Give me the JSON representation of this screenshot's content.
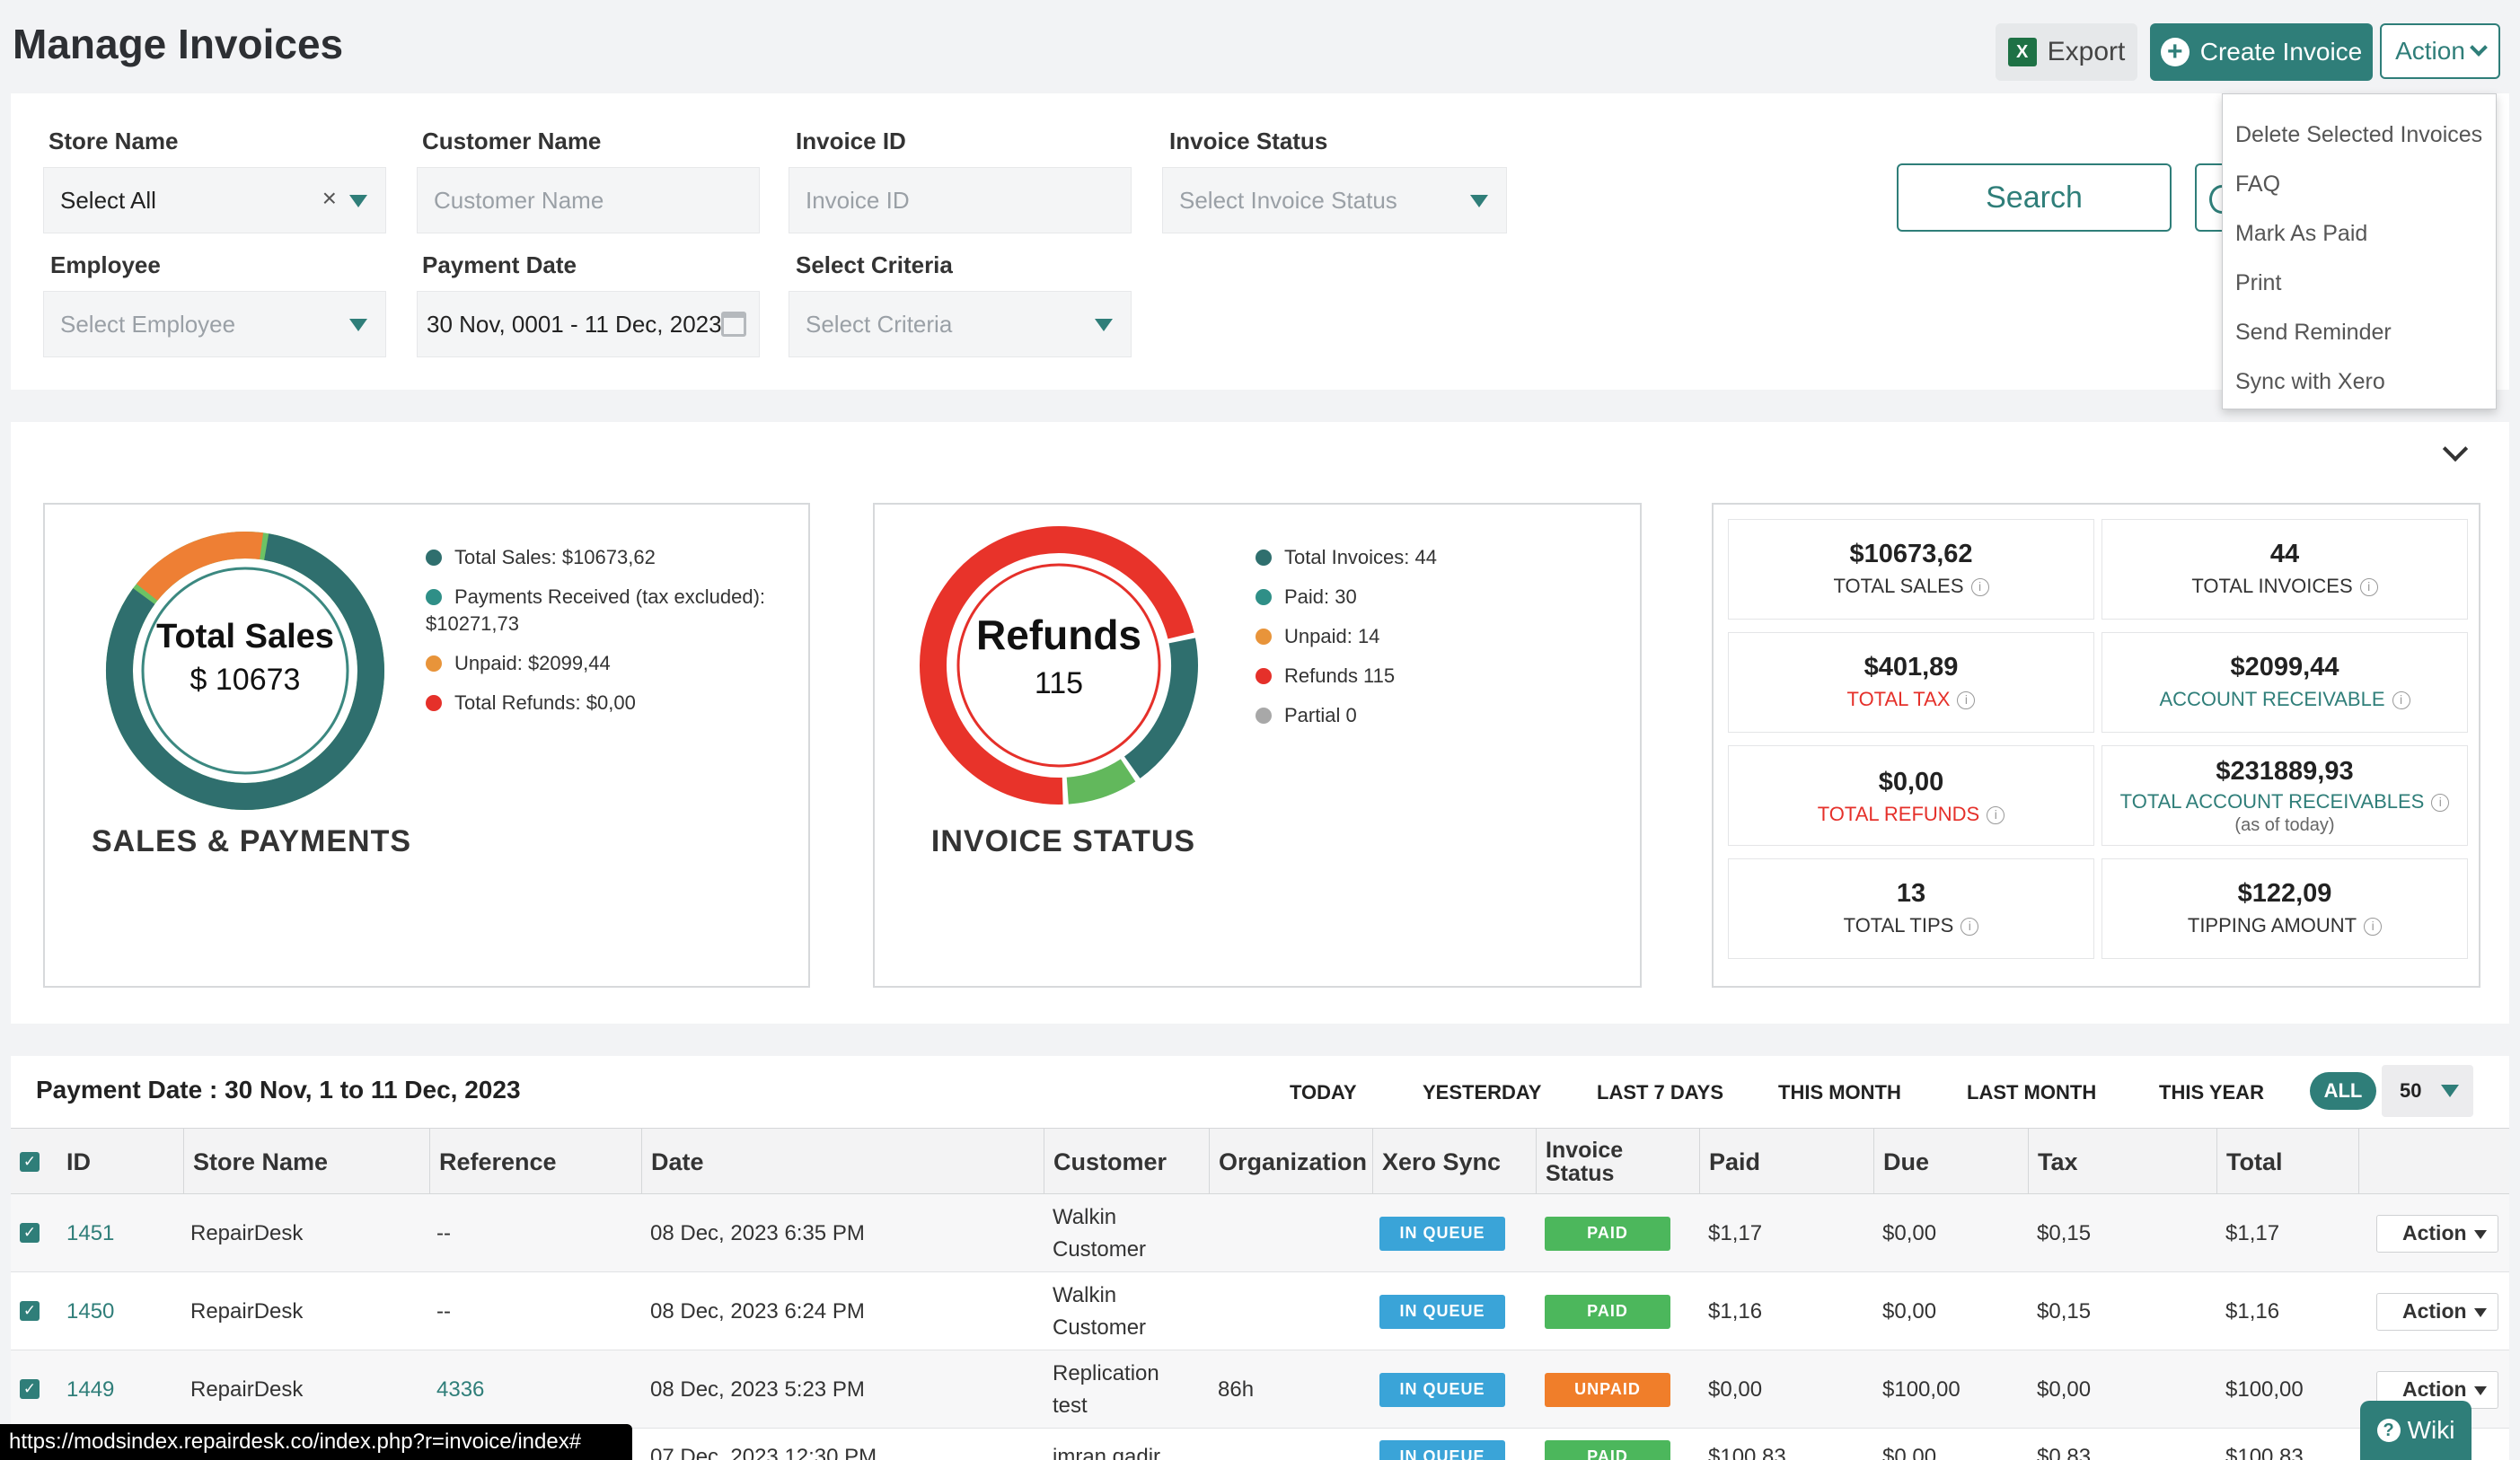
{
  "page": {
    "title": "Manage Invoices"
  },
  "toolbar": {
    "export_label": "Export",
    "create_label": "Create Invoice",
    "action_label": "Action"
  },
  "action_menu": [
    "Delete Selected Invoices",
    "FAQ",
    "Mark As Paid",
    "Print",
    "Send Reminder",
    "Sync with Xero"
  ],
  "filters": {
    "store_name_label": "Store Name",
    "store_name_value": "Select All",
    "customer_name_label": "Customer Name",
    "customer_name_placeholder": "Customer Name",
    "invoice_id_label": "Invoice ID",
    "invoice_id_placeholder": "Invoice ID",
    "invoice_status_label": "Invoice Status",
    "invoice_status_placeholder": "Select Invoice Status",
    "employee_label": "Employee",
    "employee_placeholder": "Select Employee",
    "payment_date_label": "Payment Date",
    "payment_date_value": "30 Nov, 0001 - 11 Dec, 2023",
    "criteria_label": "Select Criteria",
    "criteria_placeholder": "Select Criteria",
    "search_label": "Search"
  },
  "sales_card": {
    "center_title": "Total Sales",
    "center_value": "$ 10673",
    "title": "SALES & PAYMENTS",
    "legend": [
      {
        "text": "Total Sales: $10673,62",
        "color": "#2f6f6e"
      },
      {
        "text": "Payments Received (tax excluded):",
        "text2": "$10271,73",
        "color": "#2f8f87"
      },
      {
        "text": "Unpaid: $2099,44",
        "color": "#e8943a"
      },
      {
        "text": "Total Refunds: $0,00",
        "color": "#e5302a"
      }
    ]
  },
  "status_card": {
    "center_title": "Refunds",
    "center_value": "115",
    "title": "INVOICE STATUS",
    "legend": [
      {
        "text": "Total Invoices: 44",
        "color": "#2f6f6e"
      },
      {
        "text": "Paid: 30",
        "color": "#2f8f87"
      },
      {
        "text": "Unpaid: 14",
        "color": "#e8943a"
      },
      {
        "text": "Refunds 115",
        "color": "#e5302a"
      },
      {
        "text": "Partial 0",
        "color": "#a8a8a8"
      }
    ]
  },
  "stats": [
    {
      "value": "$10673,62",
      "label": "TOTAL SALES",
      "style": ""
    },
    {
      "value": "44",
      "label": "TOTAL INVOICES",
      "style": ""
    },
    {
      "value": "$401,89",
      "label": "TOTAL TAX",
      "style": "red"
    },
    {
      "value": "$2099,44",
      "label": "ACCOUNT RECEIVABLE",
      "style": "teal"
    },
    {
      "value": "$0,00",
      "label": "TOTAL REFUNDS",
      "style": "red"
    },
    {
      "value": "$231889,93",
      "label": "TOTAL ACCOUNT RECEIVABLES",
      "sub": "(as of today)",
      "style": "teal"
    },
    {
      "value": "13",
      "label": "TOTAL TIPS",
      "style": ""
    },
    {
      "value": "$122,09",
      "label": "TIPPING AMOUNT",
      "style": ""
    }
  ],
  "table": {
    "payment_date_label": "Payment Date : 30 Nov, 1 to 11 Dec, 2023",
    "ranges": [
      "TODAY",
      "YESTERDAY",
      "LAST 7 DAYS",
      "THIS MONTH",
      "LAST MONTH",
      "THIS YEAR",
      "ALL"
    ],
    "per_page": "50",
    "columns": [
      "ID",
      "Store Name",
      "Reference",
      "Date",
      "Customer",
      "Organization",
      "Xero Sync",
      "Invoice",
      "Status",
      "Paid",
      "Due",
      "Tax",
      "Total"
    ],
    "rows": [
      {
        "id": "1451",
        "store": "RepairDesk",
        "ref": "--",
        "date": "08 Dec, 2023 6:35 PM",
        "customer1": "Walkin",
        "customer2": "Customer",
        "org": "",
        "xero": "IN QUEUE",
        "status": "PAID",
        "paid": "$1,17",
        "due": "$0,00",
        "tax": "$0,15",
        "total": "$1,17",
        "action": "Action"
      },
      {
        "id": "1450",
        "store": "RepairDesk",
        "ref": "--",
        "date": "08 Dec, 2023 6:24 PM",
        "customer1": "Walkin",
        "customer2": "Customer",
        "org": "",
        "xero": "IN QUEUE",
        "status": "PAID",
        "paid": "$1,16",
        "due": "$0,00",
        "tax": "$0,15",
        "total": "$1,16",
        "action": "Action"
      },
      {
        "id": "1449",
        "store": "RepairDesk",
        "ref": "4336",
        "date": "08 Dec, 2023 5:23 PM",
        "customer1": "Replication",
        "customer2": "test",
        "org": "86h",
        "xero": "IN QUEUE",
        "status": "UNPAID",
        "paid": "$0,00",
        "due": "$100,00",
        "tax": "$0,00",
        "total": "$100,00",
        "action": "Action"
      },
      {
        "id": "",
        "store": "",
        "ref": "",
        "date": "07 Dec, 2023 12:30 PM",
        "customer1": "imran qadir",
        "customer2": "",
        "org": "",
        "xero": "IN QUEUE",
        "status": "PAID",
        "paid": "$100,83",
        "due": "$0,00",
        "tax": "$0,83",
        "total": "$100,83",
        "action": ""
      }
    ]
  },
  "status_bar": {
    "url": "https://modsindex.repairdesk.co/index.php?r=invoice/index#"
  },
  "wiki": {
    "label": "Wiki"
  },
  "chart_data": [
    {
      "type": "pie",
      "name": "sales-donut",
      "categories": [
        "Payments Received",
        "Unpaid",
        "Refunds"
      ],
      "values": [
        10271.73,
        2099.44,
        0
      ],
      "colors": [
        "#2f6f6e",
        "#ee7f34",
        "#e5302a"
      ]
    },
    {
      "type": "pie",
      "name": "status-donut",
      "categories": [
        "Refunds",
        "Paid",
        "Unpaid",
        "Partial"
      ],
      "values": [
        115,
        30,
        14,
        0
      ],
      "colors": [
        "#e8332a",
        "#2f6f6e",
        "#62b85c",
        "#ee8c3a"
      ]
    }
  ]
}
